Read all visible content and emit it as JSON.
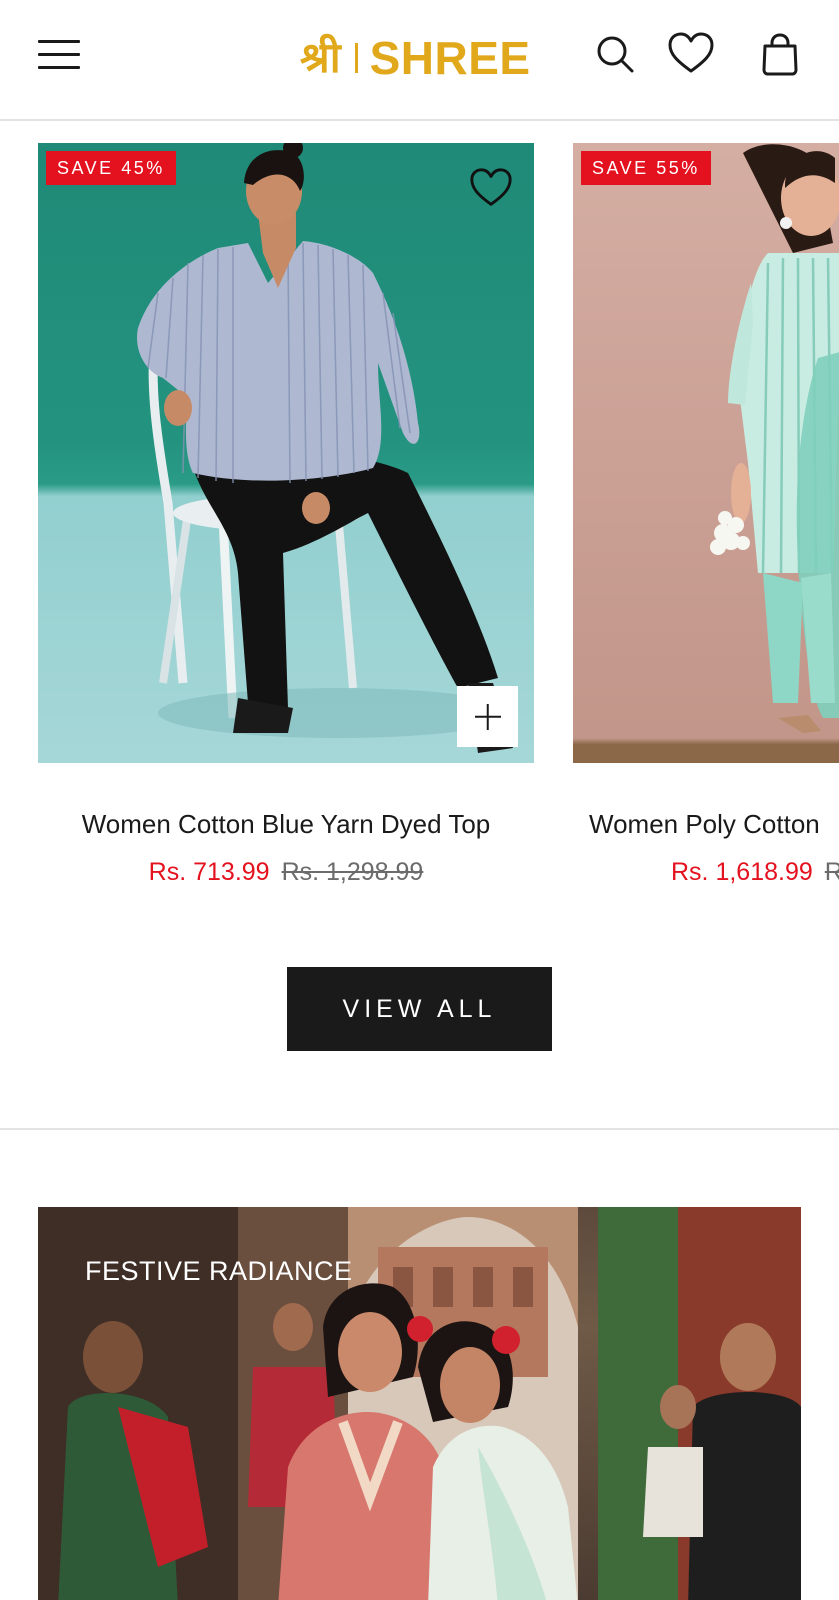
{
  "header": {
    "logo_hindi": "श्री",
    "logo_text": "SHREE",
    "icons": [
      "menu-icon",
      "search-icon",
      "heart-icon",
      "bag-icon"
    ]
  },
  "products": [
    {
      "badge": "SAVE 45%",
      "title": "Women Cotton Blue Yarn Dyed Top",
      "sale_price": "Rs. 713.99",
      "original_price": "Rs. 1,298.99",
      "add_symbol": "+"
    },
    {
      "badge": "SAVE 55%",
      "title": "Women Poly Cotton",
      "sale_price": "Rs. 1,618.99",
      "original_price": "R"
    }
  ],
  "view_all_label": "VIEW ALL",
  "banner": {
    "title": "FESTIVE RADIANCE"
  },
  "colors": {
    "brand": "#e0a81a",
    "sale": "#e4121f",
    "button": "#1a1a1a"
  }
}
